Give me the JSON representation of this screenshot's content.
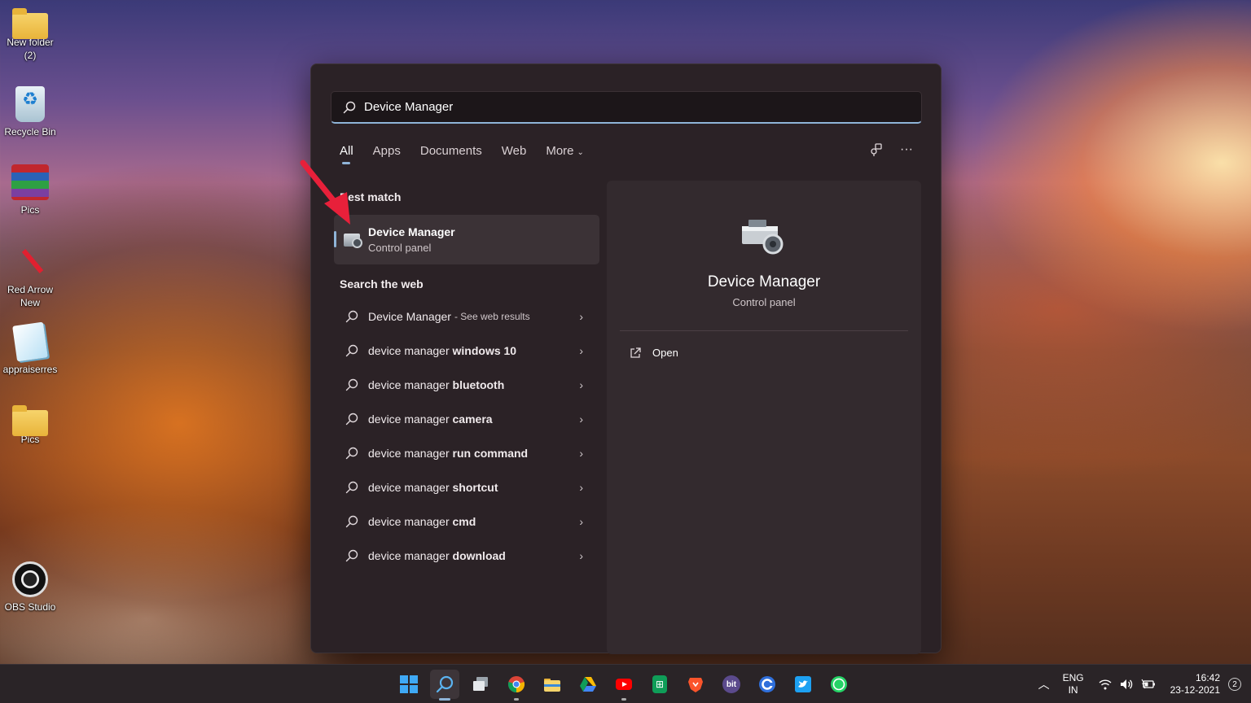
{
  "desktop": {
    "icons": [
      {
        "label": "New folder (2)"
      },
      {
        "label": "Recycle Bin"
      },
      {
        "label": "Pics"
      },
      {
        "label": "Red Arrow New"
      },
      {
        "label": "appraiserres"
      },
      {
        "label": "Pics"
      },
      {
        "label": "OBS Studio"
      }
    ]
  },
  "search": {
    "query": "Device Manager",
    "tabs": [
      {
        "label": "All",
        "active": true
      },
      {
        "label": "Apps"
      },
      {
        "label": "Documents"
      },
      {
        "label": "Web"
      },
      {
        "label": "More"
      }
    ],
    "more_chevron": "⌄",
    "actions_more": "···"
  },
  "best_match": {
    "heading": "Best match",
    "title": "Device Manager",
    "subtitle": "Control panel"
  },
  "web": {
    "heading": "Search the web",
    "items": [
      {
        "normal": "Device Manager",
        "bold": "",
        "suffix": "- See web results"
      },
      {
        "normal": "device manager ",
        "bold": "windows 10",
        "suffix": ""
      },
      {
        "normal": "device manager ",
        "bold": "bluetooth",
        "suffix": ""
      },
      {
        "normal": "device manager ",
        "bold": "camera",
        "suffix": ""
      },
      {
        "normal": "device manager ",
        "bold": "run command",
        "suffix": ""
      },
      {
        "normal": "device manager ",
        "bold": "shortcut",
        "suffix": ""
      },
      {
        "normal": "device manager ",
        "bold": "cmd",
        "suffix": ""
      },
      {
        "normal": "device manager ",
        "bold": "download",
        "suffix": ""
      }
    ]
  },
  "detail": {
    "title": "Device Manager",
    "subtitle": "Control panel",
    "open_label": "Open"
  },
  "taskbar": {
    "apps": [
      "windows-start",
      "search",
      "task-view",
      "chrome",
      "file-explorer",
      "google-drive",
      "youtube",
      "google-sheets",
      "brave",
      "bit",
      "ccleaner",
      "twitter",
      "whatsapp"
    ],
    "bit_label": "bit",
    "sheets_label": "⊞",
    "lang_1": "ENG",
    "lang_2": "IN",
    "time": "16:42",
    "date": "23-12-2021",
    "notification_count": "2"
  },
  "colors": {
    "accent": "#8fb4d8",
    "panel_bg": "#2b2226",
    "arrow_red": "#e8203a"
  }
}
